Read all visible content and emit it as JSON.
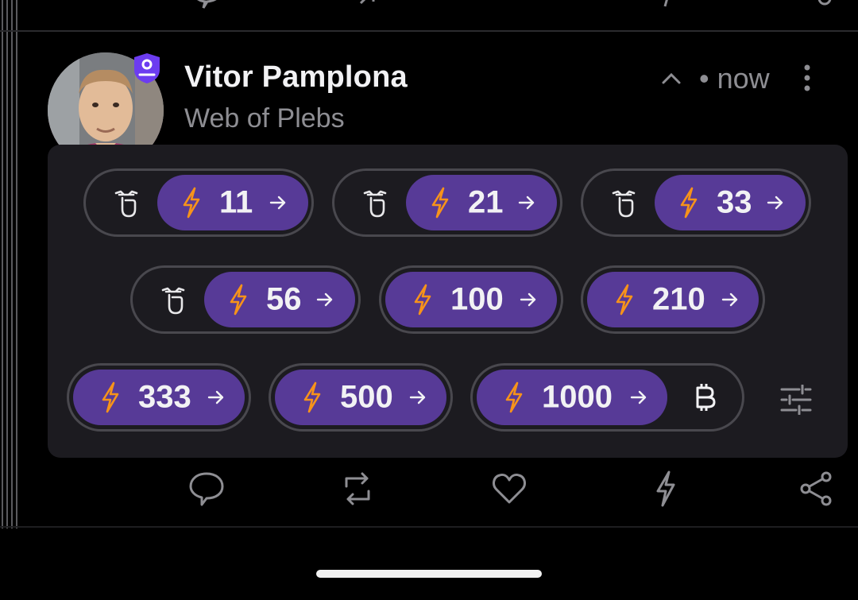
{
  "post": {
    "author_name": "Vitor Pamplona",
    "author_handle": "Web of Plebs",
    "time": "• now"
  },
  "zap_options": [
    {
      "amount": "11",
      "has_hand": true
    },
    {
      "amount": "21",
      "has_hand": true
    },
    {
      "amount": "33",
      "has_hand": true
    },
    {
      "amount": "56",
      "has_hand": true
    },
    {
      "amount": "100",
      "has_hand": false
    },
    {
      "amount": "210",
      "has_hand": false
    },
    {
      "amount": "333",
      "has_hand": false
    },
    {
      "amount": "500",
      "has_hand": false
    },
    {
      "amount": "1000",
      "has_hand": false,
      "has_bitcoin": true
    }
  ],
  "icons": {
    "bolt": "lightning-icon",
    "arrow": "arrow-right-icon",
    "hand": "touch-hand-icon",
    "bitcoin": "bitcoin-icon",
    "settings": "tune-icon",
    "actions": [
      "reply-icon",
      "repost-icon",
      "like-icon",
      "zap-icon",
      "share-icon"
    ]
  },
  "colors": {
    "background": "#000000",
    "panel": "#1c1b20",
    "pill_fill": "#573a97",
    "bolt": "#f7931a",
    "text": "#f2f2f4",
    "muted": "#8e8e93"
  }
}
